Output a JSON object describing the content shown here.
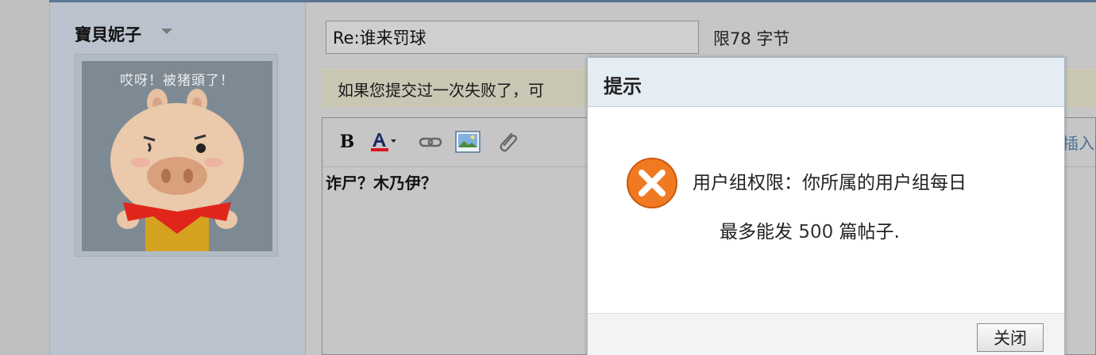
{
  "sidebar": {
    "username": "寶貝妮子",
    "avatar_caption": "哎呀！被猪頭了！"
  },
  "post": {
    "subject_value": "Re:谁来罚球",
    "limit_text": "限78 字节",
    "notice": "如果您提交过一次失败了，可",
    "editor_text": "诈尸？木乃伊？",
    "insert_link": "插入图"
  },
  "toolbar": {
    "bold_label": "B"
  },
  "dialog": {
    "title": "提示",
    "message_line1": "用户组权限：你所属的用户组每日",
    "message_line2_prefix": "最多能发 ",
    "message_count": "500",
    "message_line2_suffix": " 篇帖子.",
    "close_label": "关闭"
  },
  "colors": {
    "header_rule": "#5a7694",
    "sidebar_bg": "#bac3cd",
    "dialog_header_bg": "#e4ecf4",
    "error_orange": "#f07a22",
    "link_blue": "#4a6f9a"
  }
}
